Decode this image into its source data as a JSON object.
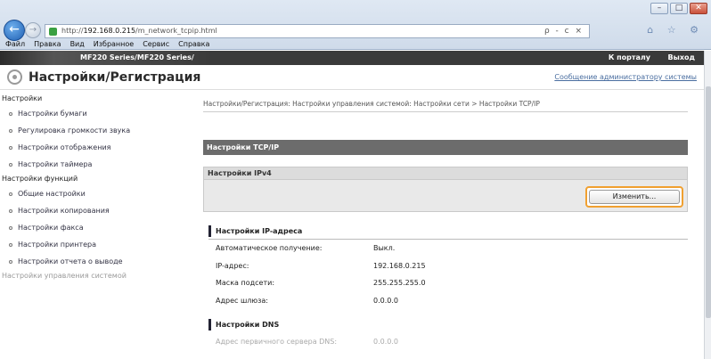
{
  "browser": {
    "address": {
      "prefix": "http://",
      "host": "192.168.0.215",
      "path": "/m_network_tcpip.html",
      "tools": "ρ - c ×"
    },
    "window_buttons": [
      "–",
      "□",
      "✕"
    ],
    "right_tools": "⌂ ☆ ⚙",
    "menu": [
      "Файл",
      "Правка",
      "Вид",
      "Избранное",
      "Сервис",
      "Справка"
    ]
  },
  "topbar": {
    "model": "MF220 Series/MF220 Series/",
    "portal": "К порталу",
    "logout": "Выход"
  },
  "header": {
    "title": "Настройки/Регистрация",
    "admin_link": "Сообщение администратору системы"
  },
  "sidebar": {
    "sections": [
      {
        "title": "Настройки",
        "items": [
          "Настройки бумаги",
          "Регулировка громкости звука",
          "Настройки отображения",
          "Настройки таймера"
        ]
      },
      {
        "title": "Настройки функций",
        "items": [
          "Общие настройки",
          "Настройки копирования",
          "Настройки факса",
          "Настройки принтера",
          "Настройки отчета о выводе"
        ]
      },
      {
        "title": "Настройки управления системой",
        "items": []
      }
    ]
  },
  "main": {
    "breadcrumb": "Настройки/Регистрация: Настройки управления системой: Настройки сети > Настройки TCP/IP",
    "section_title": "Настройки TCP/IP",
    "ipv4_title": "Настройки IPv4",
    "edit_button": "Изменить...",
    "ip_section_title": "Настройки IP-адреса",
    "rows": [
      {
        "label": "Автоматическое получение:",
        "value": "Выкл."
      },
      {
        "label": "IP-адрес:",
        "value": "192.168.0.215"
      },
      {
        "label": "Маска подсети:",
        "value": "255.255.255.0"
      },
      {
        "label": "Адрес шлюза:",
        "value": "0.0.0.0"
      }
    ],
    "dns_section_title": "Настройки DNS",
    "dns_row": {
      "label": "Адрес первичного сервера DNS:",
      "value": "0.0.0.0"
    }
  }
}
